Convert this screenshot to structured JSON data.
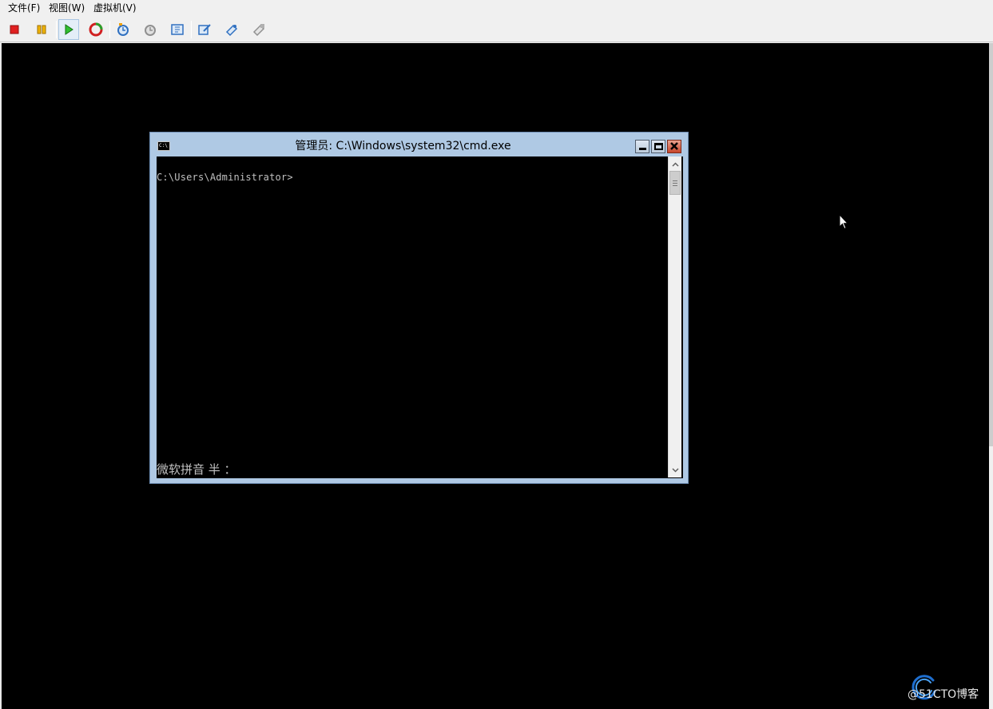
{
  "menubar": {
    "items": [
      {
        "label": "文件(F)"
      },
      {
        "label": "视图(W)"
      },
      {
        "label": "虚拟机(V)"
      }
    ]
  },
  "toolbar": {
    "buttons": [
      {
        "icon": "stop-icon"
      },
      {
        "icon": "pause-icon"
      },
      {
        "icon": "start-icon"
      },
      {
        "icon": "reset-icon"
      },
      {
        "icon": "checkpoint-icon"
      },
      {
        "icon": "revert-icon"
      },
      {
        "icon": "enhanced-session-icon"
      },
      {
        "icon": "settings-icon"
      },
      {
        "icon": "share-icon"
      },
      {
        "icon": "ctrl-alt-del-icon"
      }
    ]
  },
  "cmd_window": {
    "title": "管理员: C:\\Windows\\system32\\cmd.exe",
    "prompt": "C:\\Users\\Administrator>",
    "ime_status": "微软拼音 半 ："
  },
  "watermark": {
    "text": "@51CTO博客"
  },
  "colors": {
    "title_bar": "#afc9e4",
    "console_background": "#000000",
    "console_text": "#c0c0c0",
    "close_button": "#c7452a"
  }
}
